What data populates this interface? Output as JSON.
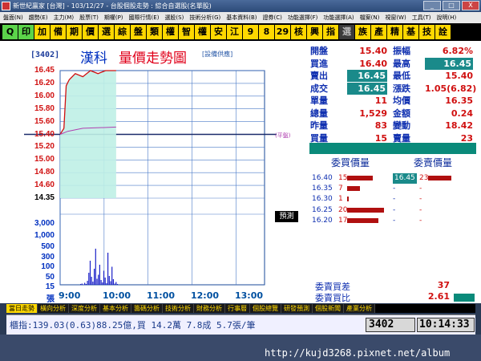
{
  "window": {
    "title": "新世紀贏家 [台灣] - 103/12/27 - 台股個股走勢 : 綜合自選股(名單股)",
    "btn_min": "_",
    "btn_max": "□",
    "btn_close": "X"
  },
  "menu": [
    "盤面(N)",
    "趨勢(E)",
    "主力(M)",
    "股票(T)",
    "期權(P)",
    "國際行情(E)",
    "選股(S)",
    "技術分析(G)",
    "基本資料(B)",
    "證券(C)",
    "功能選擇(F)",
    "功能選擇(A)",
    "檔案(N)",
    "視窗(W)",
    "工具(T)",
    "說明(H)"
  ],
  "toolbar": [
    {
      "label": "Q",
      "style": "g"
    },
    {
      "label": "印",
      "style": "g"
    },
    {
      "label": "加"
    },
    {
      "label": "備"
    },
    {
      "label": "期"
    },
    {
      "label": "價"
    },
    {
      "label": "選"
    },
    {
      "label": "綜"
    },
    {
      "label": "盤"
    },
    {
      "label": "類"
    },
    {
      "label": "權"
    },
    {
      "label": "智"
    },
    {
      "label": "權"
    },
    {
      "label": "安"
    },
    {
      "label": "江"
    },
    {
      "label": "9"
    },
    {
      "label": "8"
    },
    {
      "label": "29"
    },
    {
      "label": "核"
    },
    {
      "label": "興"
    },
    {
      "label": "指"
    },
    {
      "label": "選",
      "style": "dk"
    },
    {
      "label": "族"
    },
    {
      "label": "產"
    },
    {
      "label": "精"
    },
    {
      "label": "基"
    },
    {
      "label": "技"
    },
    {
      "label": "詮"
    }
  ],
  "stock": {
    "code": "[3402]",
    "name": "漢科",
    "title": "量價走勢圖",
    "source": "[設備供應]",
    "forecast": "預測",
    "ref_note": "(平盤)"
  },
  "price_axis": [
    "16.45",
    "16.20",
    "16.00",
    "15.80",
    "15.60",
    "15.40",
    "15.20",
    "15.00",
    "14.80",
    "14.60",
    "14.35"
  ],
  "volume_axis": [
    "3,000",
    "1,000",
    "500",
    "300",
    "100",
    "50",
    "15",
    "張"
  ],
  "time_axis": [
    "9:00",
    "10:00",
    "11:00",
    "12:00",
    "13:00"
  ],
  "chart_data": {
    "type": "line",
    "price_range": [
      14.35,
      16.45
    ],
    "reference_price": 15.4,
    "close_series": [
      {
        "t": "09:00",
        "p": 15.4
      },
      {
        "t": "09:05",
        "p": 15.5
      },
      {
        "t": "09:08",
        "p": 16.2
      },
      {
        "t": "09:12",
        "p": 16.3
      },
      {
        "t": "09:20",
        "p": 16.4
      },
      {
        "t": "09:30",
        "p": 16.35
      },
      {
        "t": "09:40",
        "p": 16.45
      },
      {
        "t": "09:50",
        "p": 16.4
      },
      {
        "t": "10:00",
        "p": 16.45
      },
      {
        "t": "10:14",
        "p": 16.45
      }
    ],
    "avg_series": [
      {
        "t": "09:00",
        "p": 15.4
      },
      {
        "t": "09:10",
        "p": 15.45
      },
      {
        "t": "09:30",
        "p": 15.5
      },
      {
        "t": "10:14",
        "p": 15.52
      }
    ],
    "volume": [
      2,
      3,
      1,
      5,
      2,
      10,
      30,
      60,
      20,
      8,
      40,
      90,
      15,
      25,
      50,
      12,
      6,
      35,
      18,
      4,
      80,
      22,
      9,
      45,
      14,
      3,
      7,
      2
    ]
  },
  "quote": [
    {
      "l1": "開盤",
      "v1": "15.40",
      "c1": "#d01010",
      "l2": "振幅",
      "v2": "6.82%",
      "c2": "#d01010"
    },
    {
      "l1": "買進",
      "v1": "16.40",
      "c1": "#d01010",
      "l2": "最高",
      "v2": "16.45",
      "c2": "#fff",
      "h2": true
    },
    {
      "l1": "賣出",
      "v1": "16.45",
      "c1": "#fff",
      "h1": true,
      "l2": "最低",
      "v2": "15.40",
      "c2": "#d01010"
    },
    {
      "l1": "成交",
      "v1": "16.45",
      "c1": "#fff",
      "h1": true,
      "l2": "漲跌",
      "v2": "1.05(6.82)",
      "c2": "#d01010"
    },
    {
      "l1": "單量",
      "v1": "11",
      "c1": "#d01010",
      "l2": "均價",
      "v2": "16.35",
      "c2": "#d01010"
    },
    {
      "l1": "總量",
      "v1": "1,529",
      "c1": "#d01010",
      "l2": "金額",
      "v2": "0.24",
      "c2": "#d01010"
    },
    {
      "l1": "昨量",
      "v1": "83",
      "c1": "#d01010",
      "l2": "變動",
      "v2": "18.42",
      "c2": "#d01010"
    },
    {
      "l1": "買量",
      "v1": "15",
      "c1": "#d01010",
      "l2": "賣量",
      "v2": "23",
      "c2": "#d01010"
    }
  ],
  "order_book": {
    "buy_header": "委買價量",
    "sell_header": "委賣價量",
    "buy": [
      {
        "p": "16.40",
        "q": "15",
        "w": 0.7
      },
      {
        "p": "16.35",
        "q": "7",
        "w": 0.35
      },
      {
        "p": "16.30",
        "q": "1",
        "w": 0.05
      },
      {
        "p": "16.25",
        "q": "20",
        "w": 1
      },
      {
        "p": "16.20",
        "q": "17",
        "w": 0.85
      }
    ],
    "sell": [
      {
        "p": "16.45",
        "q": "23",
        "w": 0.6
      },
      {
        "p": "-",
        "q": "-",
        "w": 0
      },
      {
        "p": "-",
        "q": "-",
        "w": 0
      },
      {
        "p": "-",
        "q": "-",
        "w": 0
      },
      {
        "p": "-",
        "q": "-",
        "w": 0
      }
    ]
  },
  "stats": {
    "diff_label": "委賣買差",
    "diff_value": "37",
    "ratio_label": "委賣買比",
    "ratio_value": "2.61"
  },
  "tabs": [
    "當日走勢",
    "橫向分析",
    "深度分析",
    "基本分析",
    "籌碼分析",
    "技術分析",
    "財務分析",
    "行事曆",
    "個股總覽",
    "研發預測",
    "個股新聞",
    "產業分析"
  ],
  "status": {
    "text": "櫃指:139.03(0.63)88.25億,買 14.2萬 7.8成 5.7張/筆",
    "code": "3402",
    "time": "10:14:33"
  },
  "watermark": "http://kujd3268.pixnet.net/album"
}
